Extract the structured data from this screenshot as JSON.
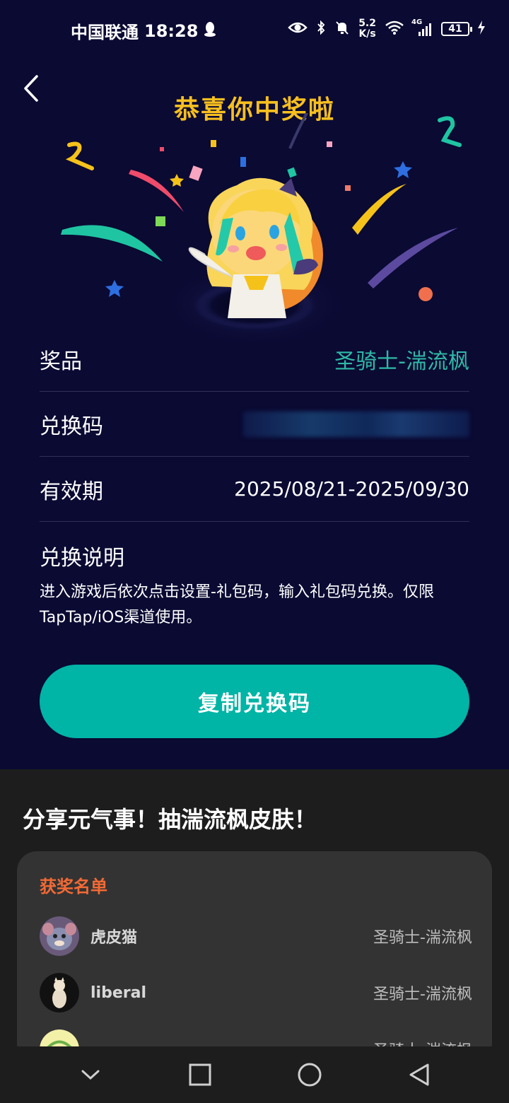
{
  "status_bar": {
    "carrier": "中国联通",
    "time": "18:28",
    "net_speed": "5.2",
    "net_unit": "K/s",
    "network": "4G",
    "battery": "41"
  },
  "header": {
    "title": "恭喜你中奖啦"
  },
  "details": {
    "prize_label": "奖品",
    "prize_value": "圣骑士-湍流枫",
    "code_label": "兑换码",
    "validity_label": "有效期",
    "validity_value": "2025/08/21-2025/09/30",
    "instructions_label": "兑换说明",
    "instructions_text": "进入游戏后依次点击设置-礼包码，输入礼包码兑换。仅限TapTap/iOS渠道使用。"
  },
  "copy_button": "复制兑换码",
  "share": {
    "title": "分享元气事！抽湍流枫皮肤！"
  },
  "winners": {
    "title": "获奖名单",
    "items": [
      {
        "name": "虎皮猫",
        "prize": "圣骑士-湍流枫"
      },
      {
        "name": "liberal",
        "prize": "圣骑士-湍流枫"
      },
      {
        "name": "",
        "prize": "圣骑士-湍流枫"
      }
    ]
  },
  "colors": {
    "background": "#0a0a33",
    "title_gold": "#f7bf1f",
    "accent_teal": "#00b4a6",
    "prize_teal": "#2fb9a6",
    "winners_orange": "#f26a35"
  }
}
